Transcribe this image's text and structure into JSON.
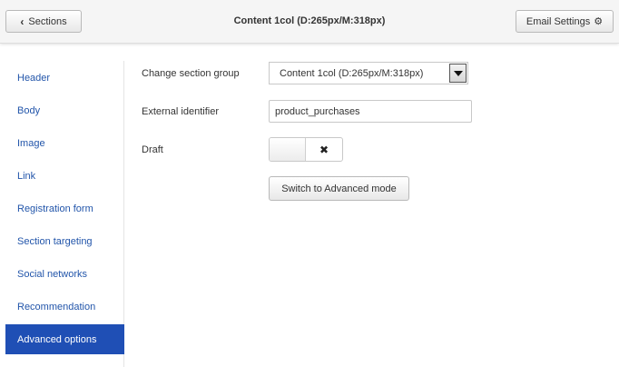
{
  "header": {
    "back_label": "Sections",
    "back_icon": "chevron-left",
    "title": "Content 1col (D:265px/M:318px)",
    "settings_label": "Email Settings",
    "settings_icon": "gear"
  },
  "sidebar": {
    "items": [
      {
        "label": "Header",
        "active": false
      },
      {
        "label": "Body",
        "active": false
      },
      {
        "label": "Image",
        "active": false
      },
      {
        "label": "Link",
        "active": false
      },
      {
        "label": "Registration form",
        "active": false
      },
      {
        "label": "Section targeting",
        "active": false
      },
      {
        "label": "Social networks",
        "active": false
      },
      {
        "label": "Recommendation",
        "active": false
      },
      {
        "label": "Advanced options",
        "active": true
      }
    ],
    "active_color": "#1f4fb5"
  },
  "form": {
    "section_group_label": "Change section group",
    "section_group_value": "Content 1col (D:265px/M:318px)",
    "external_id_label": "External identifier",
    "external_id_value": "product_purchases",
    "draft_label": "Draft",
    "draft_enabled": false,
    "draft_off_symbol": "✖",
    "advanced_button_label": "Switch to Advanced mode"
  }
}
